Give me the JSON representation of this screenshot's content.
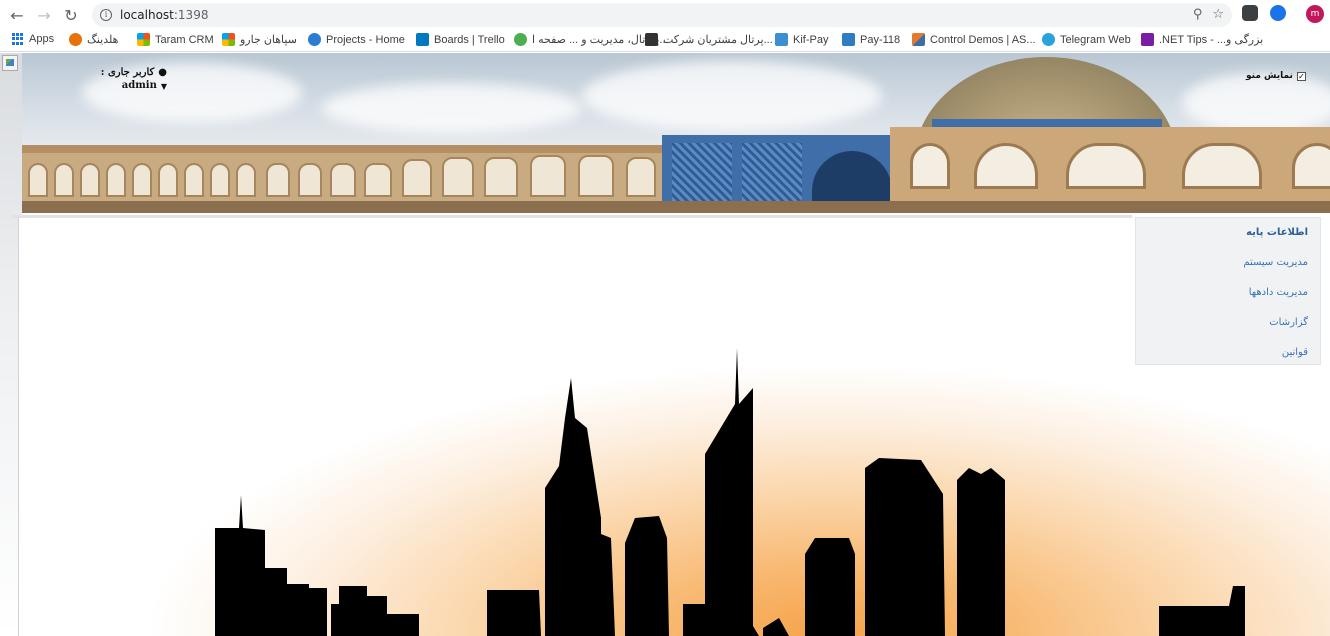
{
  "browser": {
    "url_host": "localhost",
    "url_port": ":1398",
    "avatar_letter": "m"
  },
  "bookmarks": [
    {
      "label": "Apps",
      "color": "#1a73e8"
    },
    {
      "label": "هلدینگ",
      "color": "#e8710a"
    },
    {
      "label": "Taram CRM",
      "color": "#f25022"
    },
    {
      "label": "سپاهان جارو",
      "color": "#7fba00"
    },
    {
      "label": "Projects - Home",
      "color": "#2b7cd3"
    },
    {
      "label": "Boards | Trello",
      "color": "#0079bf"
    },
    {
      "label": "پورتال، مدیریت و ... صفحه ا...",
      "color": "#4caf50"
    },
    {
      "label": "پرتال مشتریان شرکت...",
      "color": "#333333"
    },
    {
      "label": "Kif-Pay",
      "color": "#3c8fd0"
    },
    {
      "label": "Pay-118",
      "color": "#2f7dc0"
    },
    {
      "label": "Control Demos | AS...",
      "color": "#e57a2c"
    },
    {
      "label": "Telegram Web",
      "color": "#2aa3db"
    },
    {
      "label": ".NET Tips - ...بزرگی و",
      "color": "#7b1fa2"
    }
  ],
  "header": {
    "user_label": "کاربر جاری :",
    "user_name": "admin",
    "menu_toggle_label": "نمایش منو",
    "menu_toggle_checked": true
  },
  "sidebar": {
    "items": [
      {
        "label": "اطلاعات پایه"
      },
      {
        "label": "مدیریت سیستم"
      },
      {
        "label": "مدیریت دادهها"
      },
      {
        "label": "گزارشات"
      },
      {
        "label": "قوانین"
      }
    ]
  }
}
